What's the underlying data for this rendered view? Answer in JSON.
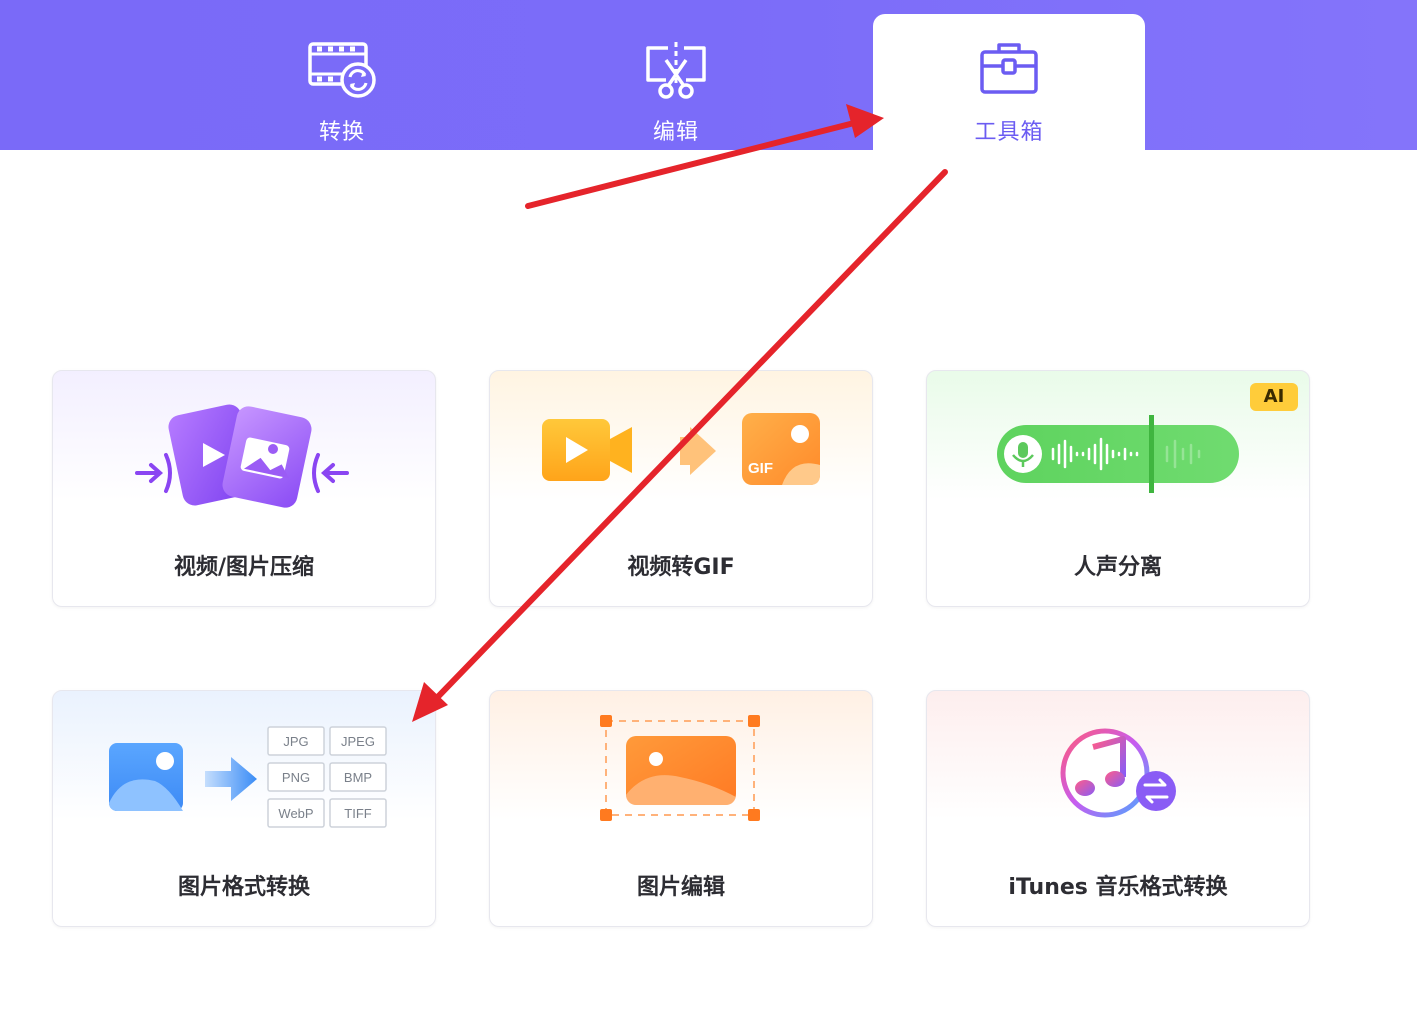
{
  "tabs": [
    {
      "label": "转换",
      "icon": "video-convert-icon",
      "active": false
    },
    {
      "label": "编辑",
      "icon": "scissors-edit-icon",
      "active": false
    },
    {
      "label": "工具箱",
      "icon": "toolbox-icon",
      "active": true
    }
  ],
  "tools": [
    {
      "label": "视频/图片压缩",
      "icon": "compress-icon"
    },
    {
      "label": "视频转GIF",
      "icon": "video-to-gif-icon",
      "icon_text": "GIF"
    },
    {
      "label": "人声分离",
      "icon": "vocal-separation-icon",
      "badge": "AI"
    },
    {
      "label": "图片格式转换",
      "icon": "image-format-convert-icon",
      "formats": [
        "JPG",
        "JPEG",
        "PNG",
        "BMP",
        "WebP",
        "TIFF"
      ]
    },
    {
      "label": "图片编辑",
      "icon": "image-edit-icon"
    },
    {
      "label": "iTunes 音乐格式转换",
      "icon": "itunes-music-convert-icon"
    }
  ],
  "colors": {
    "header": "#7b6cf9",
    "active_tab_text": "#6b5cf2",
    "annotation_arrow": "#e5242b",
    "ai_badge": "#ffcc3a"
  }
}
